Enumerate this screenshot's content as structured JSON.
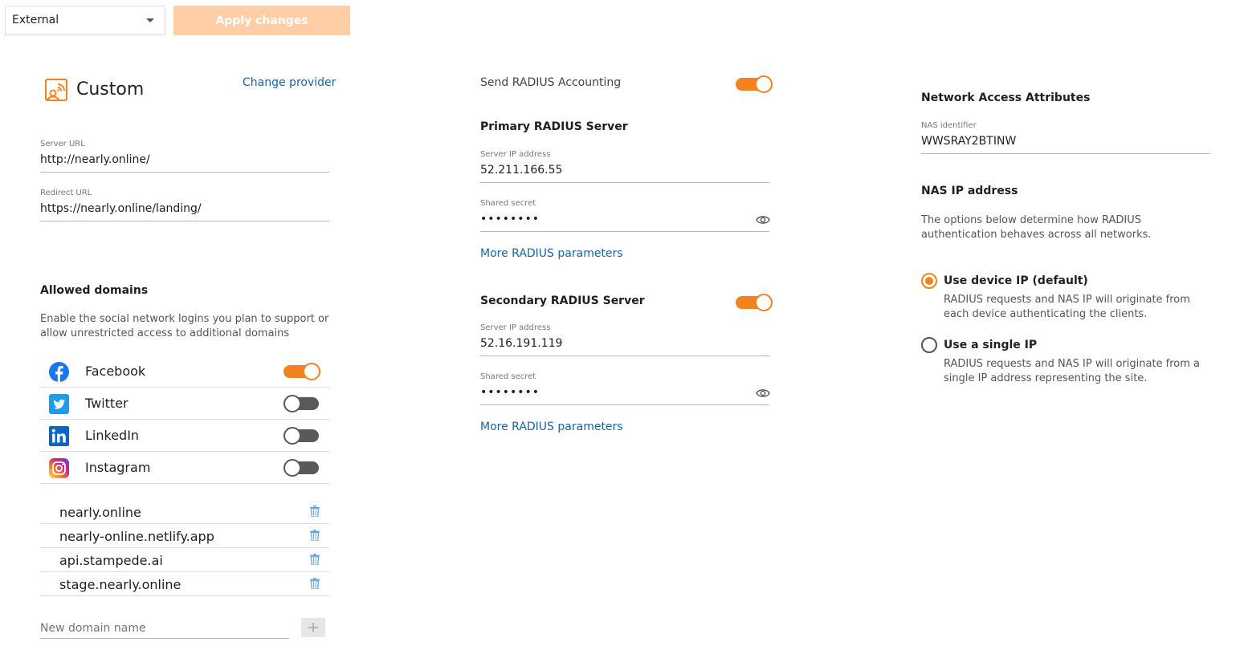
{
  "toolbar": {
    "mode_select": "External",
    "apply_label": "Apply changes"
  },
  "provider": {
    "name": "Custom",
    "change_link": "Change provider",
    "server_url_label": "Server URL",
    "server_url": "http://nearly.online/",
    "redirect_url_label": "Redirect URL",
    "redirect_url": "https://nearly.online/landing/"
  },
  "allowed_domains": {
    "title": "Allowed domains",
    "description": "Enable the social network logins you plan to support or allow unrestricted access to additional domains",
    "socials": [
      {
        "name": "Facebook",
        "enabled": true
      },
      {
        "name": "Twitter",
        "enabled": false
      },
      {
        "name": "LinkedIn",
        "enabled": false
      },
      {
        "name": "Instagram",
        "enabled": false
      }
    ],
    "domains": [
      "nearly.online",
      "nearly-online.netlify.app",
      "api.stampede.ai",
      "stage.nearly.online"
    ],
    "new_domain_placeholder": "New domain name"
  },
  "radius": {
    "accounting_label": "Send RADIUS Accounting",
    "accounting_enabled": true,
    "primary": {
      "title": "Primary RADIUS Server",
      "ip_label": "Server IP address",
      "ip": "52.211.166.55",
      "secret_label": "Shared secret",
      "secret": "••••••••",
      "more_link": "More RADIUS parameters"
    },
    "secondary": {
      "title": "Secondary RADIUS Server",
      "enabled": true,
      "ip_label": "Server IP address",
      "ip": "52.16.191.119",
      "secret_label": "Shared secret",
      "secret": "••••••••",
      "more_link": "More RADIUS parameters"
    }
  },
  "nas": {
    "title": "Network Access Attributes",
    "identifier_label": "NAS identifier",
    "identifier": "WWSRAY2BTINW",
    "ip_title": "NAS IP address",
    "ip_description": "The options below determine how RADIUS authentication behaves across all networks.",
    "options": [
      {
        "label": "Use device IP (default)",
        "description": "RADIUS requests and NAS IP will originate from each device authenticating the clients.",
        "selected": true
      },
      {
        "label": "Use a single IP",
        "description": "RADIUS requests and NAS IP will originate from a single IP address representing the site.",
        "selected": false
      }
    ]
  },
  "colors": {
    "accent": "#f58220",
    "link": "#1a63a8",
    "apply_disabled": "#ffcda6"
  }
}
